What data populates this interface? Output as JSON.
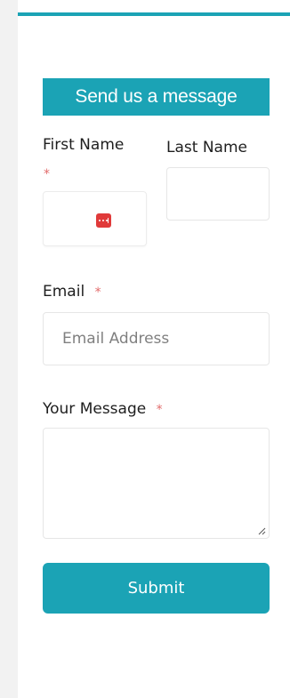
{
  "form": {
    "title": "Send us a message",
    "first_name": {
      "label": "First Name",
      "required_mark": "*"
    },
    "last_name": {
      "label": "Last Name"
    },
    "email": {
      "label": "Email",
      "required_mark": "*",
      "placeholder": "Email Address"
    },
    "message": {
      "label": "Your Message",
      "required_mark": "*"
    },
    "submit_label": "Submit"
  },
  "icons": {
    "first_name_field": "password-manager-icon",
    "message_field": "resize-handle-icon"
  },
  "colors": {
    "accent": "#1ba3b5",
    "required": "#e26b6b",
    "password_manager_icon": "#e03a3a"
  }
}
